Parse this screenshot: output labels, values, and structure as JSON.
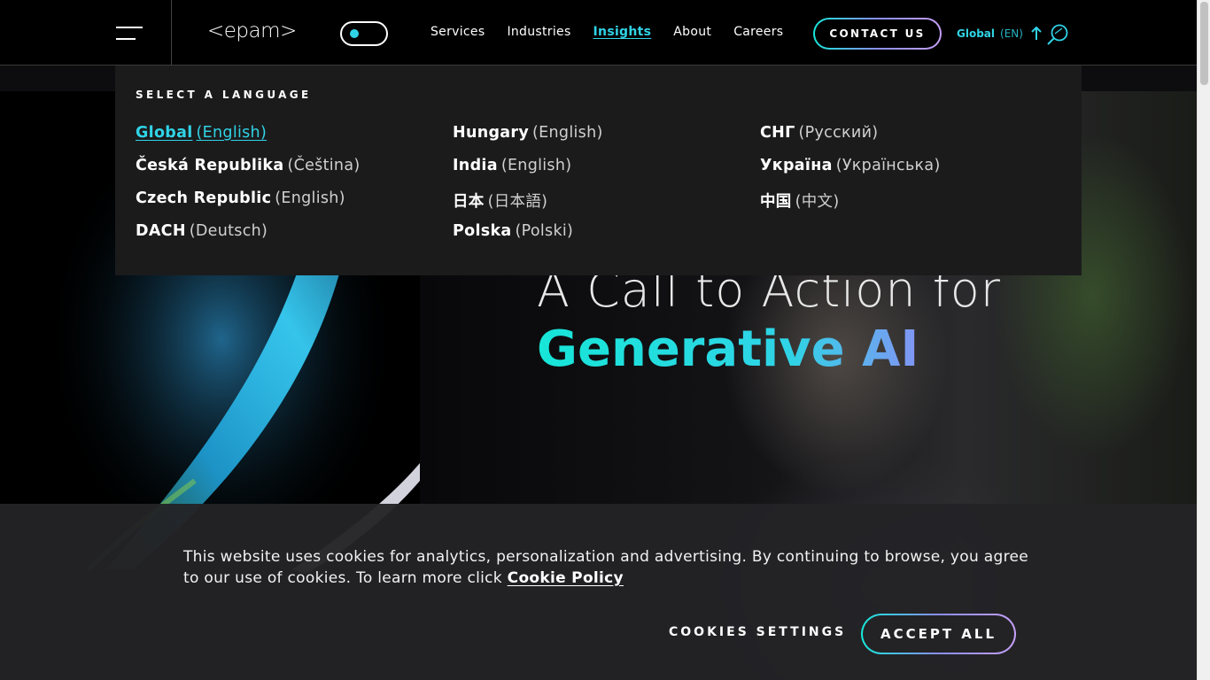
{
  "header": {
    "logo_text": "<epam>",
    "nav": [
      {
        "label": "Services",
        "active": false
      },
      {
        "label": "Industries",
        "active": false
      },
      {
        "label": "Insights",
        "active": true
      },
      {
        "label": "About",
        "active": false
      },
      {
        "label": "Careers",
        "active": false
      }
    ],
    "contact_label": "CONTACT US",
    "lang_region": "Global",
    "lang_code": "(EN)"
  },
  "language_panel": {
    "heading": "SELECT A LANGUAGE",
    "columns": [
      [
        {
          "country": "Global",
          "lang": "(English)",
          "selected": true
        },
        {
          "country": "Česká Republika",
          "lang": "(Čeština)"
        },
        {
          "country": "Czech Republic",
          "lang": "(English)"
        },
        {
          "country": "DACH",
          "lang": "(Deutsch)"
        }
      ],
      [
        {
          "country": "Hungary",
          "lang": "(English)"
        },
        {
          "country": "India",
          "lang": "(English)"
        },
        {
          "country": "日本",
          "lang": "(日本語)"
        },
        {
          "country": "Polska",
          "lang": "(Polski)"
        }
      ],
      [
        {
          "country": "СНГ",
          "lang": "(Русский)"
        },
        {
          "country": "Україна",
          "lang": "(Українська)"
        },
        {
          "country": "中国",
          "lang": "(中文)"
        }
      ]
    ]
  },
  "hero": {
    "title_line1": "A Call to Action for",
    "title_line2": "Generative AI"
  },
  "cookie_banner": {
    "text": "This website uses cookies for analytics, personalization and advertising. By continuing to browse, you agree to our use of cookies. To learn more click ",
    "policy_link": "Cookie Policy",
    "settings_label": "COOKIES SETTINGS",
    "accept_label": "ACCEPT ALL"
  },
  "colors": {
    "accent": "#30d3e6",
    "gradient_start": "#17e6d8",
    "gradient_end": "#c59ff5",
    "panel_bg": "#1b1b1c"
  }
}
